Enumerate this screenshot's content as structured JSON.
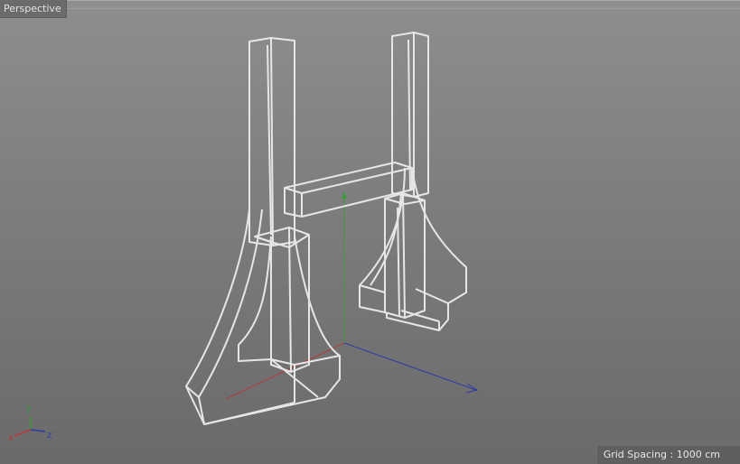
{
  "viewport": {
    "title": "Perspective",
    "grid_spacing": "Grid Spacing : 1000 cm",
    "colors": {
      "background_top": "#8e8e8e",
      "background_bottom": "#6a6a6a",
      "wireframe": "#e6e6e6",
      "y_axis": "#3d9a3d",
      "x_axis": "#b43a3a",
      "z_axis": "#2e3aa6"
    }
  },
  "axis_gizmo": {
    "x_label": "x",
    "y_label": "y",
    "z_label": "z"
  }
}
